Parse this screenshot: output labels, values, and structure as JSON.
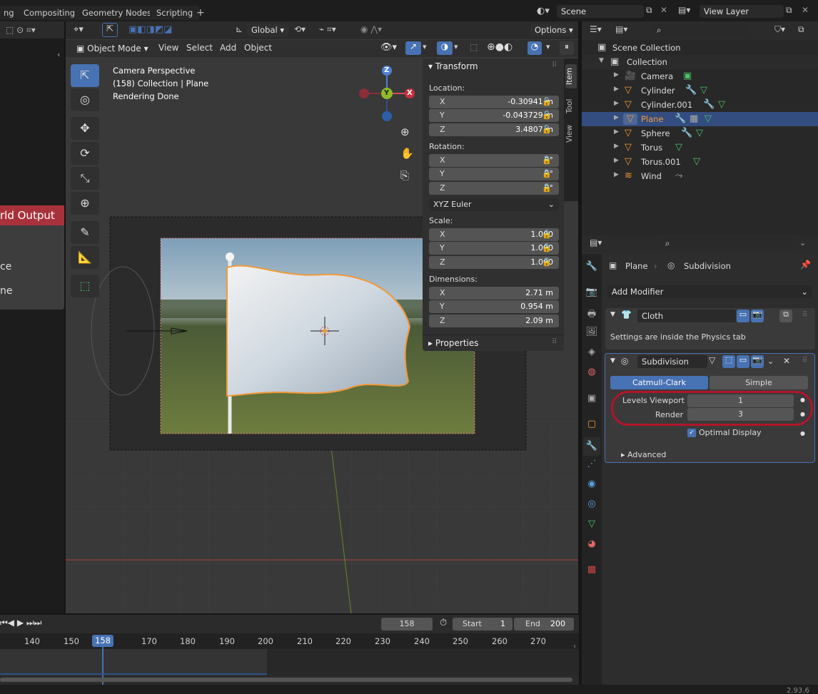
{
  "topbar": {
    "workspaces": [
      "ng",
      "Compositing",
      "Geometry Nodes",
      "Scripting"
    ],
    "add_label": "+",
    "scene_label": "Scene",
    "view_layer_label": "View Layer"
  },
  "viewport_header": {
    "transform_orientation": "Global",
    "options_label": "Options",
    "mode": "Object Mode",
    "menus": [
      "View",
      "Select",
      "Add",
      "Object"
    ]
  },
  "viewport": {
    "overlay_lines": [
      "Camera Perspective",
      "(158) Collection | Plane",
      "Rendering Done"
    ],
    "gizmo_labels": {
      "z": "Z",
      "y": "Y",
      "x": "X"
    },
    "left_popup": {
      "title": "rld Output",
      "items": [
        "ce",
        "ne"
      ]
    }
  },
  "sidebar_tabs": [
    "Item",
    "Tool",
    "View"
  ],
  "transform": {
    "title": "Transform",
    "location_label": "Location:",
    "location": [
      {
        "k": "X",
        "v": "-0.30941 m"
      },
      {
        "k": "Y",
        "v": "-0.043729 m"
      },
      {
        "k": "Z",
        "v": "3.4807 m"
      }
    ],
    "rotation_label": "Rotation:",
    "rotation": [
      {
        "k": "X",
        "v": "0°"
      },
      {
        "k": "Y",
        "v": "0°"
      },
      {
        "k": "Z",
        "v": "0°"
      }
    ],
    "rotation_mode": "XYZ Euler",
    "scale_label": "Scale:",
    "scale": [
      {
        "k": "X",
        "v": "1.000"
      },
      {
        "k": "Y",
        "v": "1.000"
      },
      {
        "k": "Z",
        "v": "1.000"
      }
    ],
    "dimensions_label": "Dimensions:",
    "dimensions": [
      {
        "k": "X",
        "v": "2.71 m"
      },
      {
        "k": "Y",
        "v": "0.954 m"
      },
      {
        "k": "Z",
        "v": "2.09 m"
      }
    ],
    "properties_label": "Properties"
  },
  "outliner": {
    "scene_collection": "Scene Collection",
    "collection": "Collection",
    "items": [
      {
        "name": "Camera",
        "icon": "camera-icon"
      },
      {
        "name": "Cylinder",
        "icon": "mesh-icon"
      },
      {
        "name": "Cylinder.001",
        "icon": "mesh-icon"
      },
      {
        "name": "Plane",
        "icon": "mesh-icon",
        "selected": true
      },
      {
        "name": "Sphere",
        "icon": "mesh-icon"
      },
      {
        "name": "Torus",
        "icon": "mesh-icon"
      },
      {
        "name": "Torus.001",
        "icon": "mesh-icon"
      },
      {
        "name": "Wind",
        "icon": "wind-icon"
      }
    ]
  },
  "properties": {
    "breadcrumb_object": "Plane",
    "breadcrumb_modifier": "Subdivision",
    "add_modifier": "Add Modifier",
    "cloth": {
      "name": "Cloth",
      "note": "Settings are inside the Physics tab"
    },
    "subdivision": {
      "name": "Subdivision",
      "method_active": "Catmull-Clark",
      "method_other": "Simple",
      "levels_viewport_label": "Levels Viewport",
      "levels_viewport": "1",
      "render_label": "Render",
      "render": "3",
      "optimal_display": "Optimal Display",
      "advanced": "Advanced"
    }
  },
  "timeline": {
    "current_frame": "158",
    "start_label": "Start",
    "start": "1",
    "end_label": "End",
    "end": "200",
    "ticks": [
      "140",
      "150",
      "158",
      "170",
      "180",
      "190",
      "200",
      "210",
      "220",
      "230",
      "240",
      "250",
      "260",
      "270"
    ]
  },
  "version": "2.93.6",
  "colors": {
    "accent": "#4772b3",
    "selected_outline": "#f19a38",
    "highlight_ring": "#b0152a",
    "header_red": "#a8323c"
  }
}
